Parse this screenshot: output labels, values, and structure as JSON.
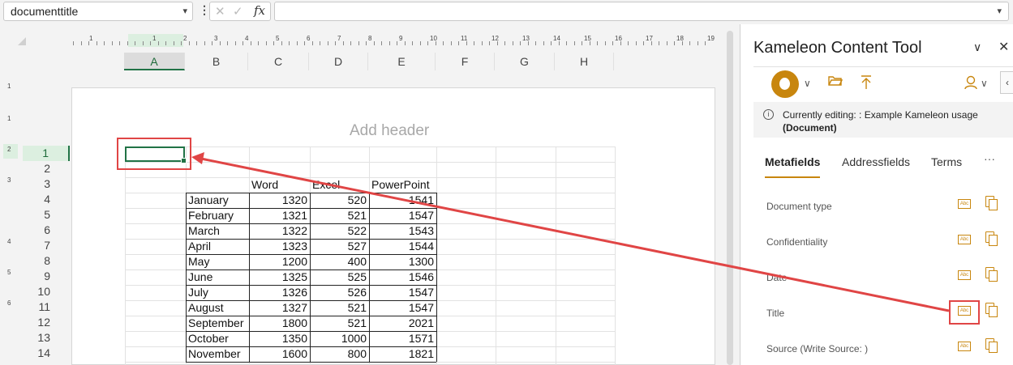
{
  "formula_bar": {
    "name_box": "documenttitle",
    "fx": "fx",
    "cancel_glyph": "✕",
    "enter_glyph": "✓",
    "formula_value": ""
  },
  "ruler": {
    "horizontal": [
      "1",
      "1",
      "2",
      "3",
      "4",
      "5",
      "6",
      "7",
      "8",
      "9",
      "10",
      "11",
      "12",
      "13",
      "14",
      "15",
      "16",
      "17",
      "18",
      "19"
    ],
    "vertical": [
      "1",
      "1",
      "2",
      "3",
      "4",
      "5",
      "6"
    ]
  },
  "columns": [
    "A",
    "B",
    "C",
    "D",
    "E",
    "F",
    "G",
    "H"
  ],
  "selected_column": "A",
  "rows": [
    "1",
    "2",
    "3",
    "4",
    "5",
    "6",
    "7",
    "8",
    "9",
    "10",
    "11",
    "12",
    "13",
    "14"
  ],
  "selected_row": "1",
  "page_header_placeholder": "Add header",
  "sheet": {
    "headers": [
      "Word",
      "Excel",
      "PowerPoint"
    ],
    "data": [
      {
        "month": "January",
        "word": "1320",
        "excel": "520",
        "ppt": "1541"
      },
      {
        "month": "February",
        "word": "1321",
        "excel": "521",
        "ppt": "1547"
      },
      {
        "month": "March",
        "word": "1322",
        "excel": "522",
        "ppt": "1543"
      },
      {
        "month": "April",
        "word": "1323",
        "excel": "527",
        "ppt": "1544"
      },
      {
        "month": "May",
        "word": "1200",
        "excel": "400",
        "ppt": "1300"
      },
      {
        "month": "June",
        "word": "1325",
        "excel": "525",
        "ppt": "1546"
      },
      {
        "month": "July",
        "word": "1326",
        "excel": "526",
        "ppt": "1547"
      },
      {
        "month": "August",
        "word": "1327",
        "excel": "521",
        "ppt": "1547"
      },
      {
        "month": "September",
        "word": "1800",
        "excel": "521",
        "ppt": "2021"
      },
      {
        "month": "October",
        "word": "1350",
        "excel": "1000",
        "ppt": "1571"
      },
      {
        "month": "November",
        "word": "1600",
        "excel": "800",
        "ppt": "1821"
      }
    ]
  },
  "pane": {
    "title": "Kameleon Content Tool",
    "collapse_glyph": "∨",
    "close_glyph": "✕",
    "side_tab_glyph": "‹",
    "notice_line1": "Currently editing: : Example Kameleon usage",
    "notice_line2": "(Document)",
    "tabs": [
      "Metafields",
      "Addressfields",
      "Terms"
    ],
    "more": "···",
    "fields": [
      "Document type",
      "Confidentiality",
      "Date",
      "Title",
      "Source (Write Source: )"
    ],
    "abc_label": "Abc",
    "colors": {
      "accent": "#c8860e",
      "annotation": "#e04545",
      "excel_green": "#217346"
    }
  }
}
